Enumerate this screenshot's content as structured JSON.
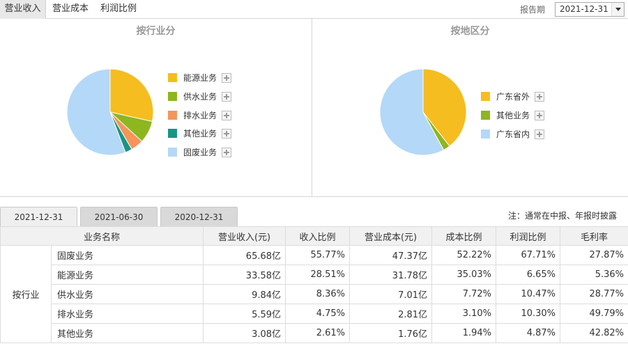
{
  "top_tabs": [
    {
      "label": "营业收入",
      "active": true
    },
    {
      "label": "营业成本",
      "active": false
    },
    {
      "label": "利润比例",
      "active": false
    }
  ],
  "report_period": {
    "label": "报告期",
    "value": "2021-12-31"
  },
  "charts": {
    "industry": {
      "title": "按行业分",
      "legend": [
        {
          "label": "能源业务",
          "color": "#f5bd1f"
        },
        {
          "label": "供水业务",
          "color": "#8db620"
        },
        {
          "label": "排水业务",
          "color": "#f5955a"
        },
        {
          "label": "其他业务",
          "color": "#1a9485"
        },
        {
          "label": "固废业务",
          "color": "#b4d8f7"
        }
      ]
    },
    "region": {
      "title": "按地区分",
      "legend": [
        {
          "label": "广东省外",
          "color": "#f5bd1f"
        },
        {
          "label": "其他业务",
          "color": "#8db620"
        },
        {
          "label": "广东省内",
          "color": "#b4d8f7"
        }
      ]
    }
  },
  "chart_data": [
    {
      "type": "pie",
      "title": "按行业分",
      "categories": [
        "能源业务",
        "供水业务",
        "排水业务",
        "其他业务",
        "固废业务"
      ],
      "values": [
        28.51,
        8.36,
        4.75,
        2.61,
        55.77
      ],
      "colors": [
        "#f5bd1f",
        "#8db620",
        "#f5955a",
        "#1a9485",
        "#b4d8f7"
      ]
    },
    {
      "type": "pie",
      "title": "按地区分",
      "categories": [
        "广东省外",
        "其他业务",
        "广东省内"
      ],
      "values": [
        39.5,
        2.6,
        57.9
      ],
      "colors": [
        "#f5bd1f",
        "#8db620",
        "#b4d8f7"
      ]
    }
  ],
  "period_tabs": [
    {
      "label": "2021-12-31",
      "active": true
    },
    {
      "label": "2021-06-30",
      "active": false
    },
    {
      "label": "2020-12-31",
      "active": false
    }
  ],
  "note": "注：通常在中报、年报时披露",
  "table": {
    "headers": [
      "业务名称",
      "营业收入(元)",
      "收入比例",
      "营业成本(元)",
      "成本比例",
      "利润比例",
      "毛利率"
    ],
    "group_label": "按行业",
    "rows": [
      [
        "固废业务",
        "65.68亿",
        "55.77%",
        "47.37亿",
        "52.22%",
        "67.71%",
        "27.87%"
      ],
      [
        "能源业务",
        "33.58亿",
        "28.51%",
        "31.78亿",
        "35.03%",
        "6.65%",
        "5.36%"
      ],
      [
        "供水业务",
        "9.84亿",
        "8.36%",
        "7.01亿",
        "7.72%",
        "10.47%",
        "28.77%"
      ],
      [
        "排水业务",
        "5.59亿",
        "4.75%",
        "2.81亿",
        "3.10%",
        "10.30%",
        "49.79%"
      ],
      [
        "其他业务",
        "3.08亿",
        "2.61%",
        "1.76亿",
        "1.94%",
        "4.87%",
        "42.82%"
      ]
    ]
  }
}
